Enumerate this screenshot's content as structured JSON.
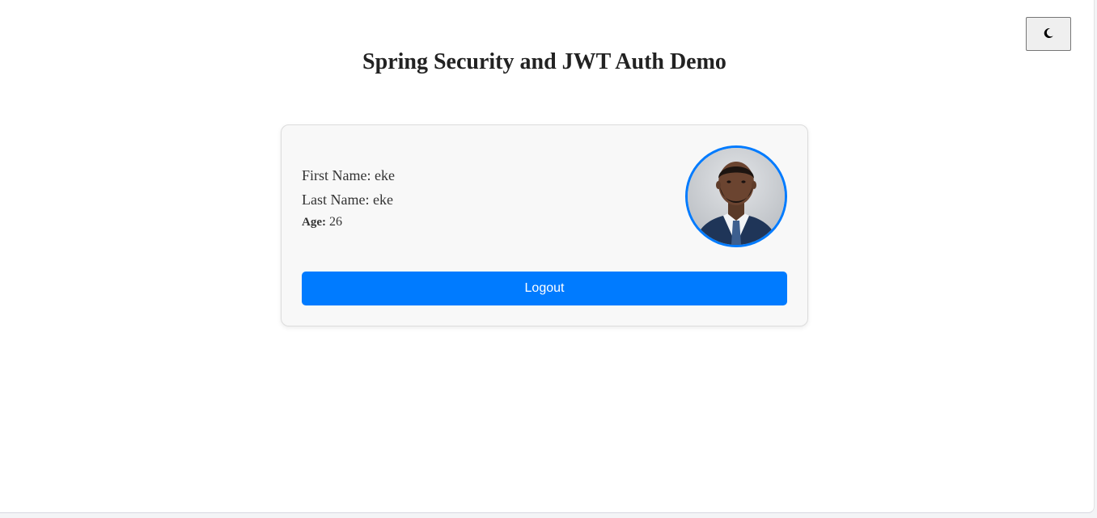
{
  "header": {
    "title": "Spring Security and JWT Auth Demo",
    "theme_toggle_icon": "moon-icon"
  },
  "profile": {
    "first_name_label": "First Name:",
    "first_name": "eke",
    "last_name_label": "Last Name:",
    "last_name": "eke",
    "age_label": "Age:",
    "age": "26",
    "avatar_icon": "profile-photo",
    "logout_label": "Logout"
  },
  "colors": {
    "accent": "#007bff",
    "card_background": "#f8f8f8",
    "page_background": "#ffffff"
  }
}
